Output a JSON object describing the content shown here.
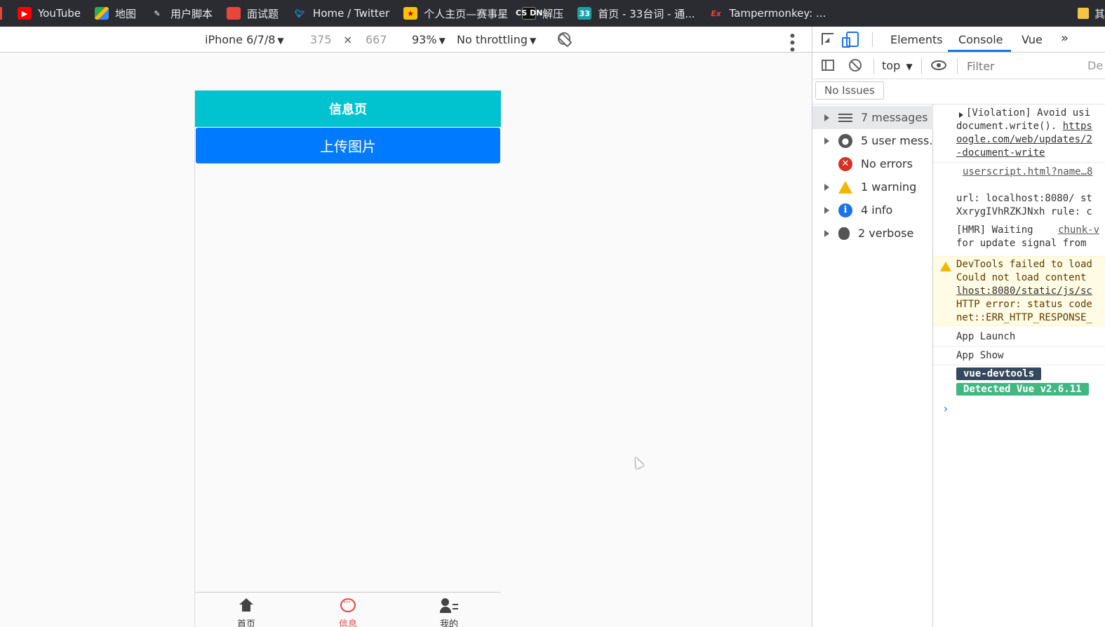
{
  "bookmarks": [
    {
      "label": "YouTube",
      "icon": "youtube-icon"
    },
    {
      "label": "地图",
      "icon": "maps-icon"
    },
    {
      "label": "用户脚本",
      "icon": "userscript-icon"
    },
    {
      "label": "面试题",
      "icon": "interview-icon"
    },
    {
      "label": "Home / Twitter",
      "icon": "twitter-icon"
    },
    {
      "label": "个人主页—赛事星",
      "icon": "star-icon"
    },
    {
      "label": "解压",
      "icon": "csdn-icon"
    },
    {
      "label": "首页 - 33台词 - 通...",
      "icon": "33-icon"
    },
    {
      "label": "Tampermonkey: ...",
      "icon": "ex-icon"
    }
  ],
  "bookmarks_right": {
    "label": "其",
    "icon": "folder-icon"
  },
  "bookmark_icon_texts": {
    "csdn": "CS DN",
    "n33": "33",
    "ex": "Ex"
  },
  "device_toolbar": {
    "device": "iPhone 6/7/8",
    "width": "375",
    "times": "×",
    "height": "667",
    "zoom": "93%",
    "throttle": "No throttling"
  },
  "app": {
    "nav_title": "信息页",
    "upload_button": "上传图片",
    "tabs": [
      {
        "label": "首页",
        "icon": "home-icon"
      },
      {
        "label": "信息",
        "icon": "message-icon"
      },
      {
        "label": "我的",
        "icon": "user-icon"
      }
    ]
  },
  "devtools": {
    "tabs": {
      "elements": "Elements",
      "console": "Console",
      "vue": "Vue",
      "more": "»"
    },
    "context": "top",
    "filter_placeholder": "Filter",
    "default_levels": "De",
    "issues": "No Issues",
    "sidebar": [
      {
        "label": "7 messages",
        "icon": "list-icon",
        "expandable": true
      },
      {
        "label": "5 user mess...",
        "icon": "user-circle-icon",
        "expandable": true
      },
      {
        "label": "No errors",
        "icon": "error-icon",
        "expandable": false
      },
      {
        "label": "1 warning",
        "icon": "warning-icon",
        "expandable": true
      },
      {
        "label": "4 info",
        "icon": "info-icon",
        "expandable": true
      },
      {
        "label": "2 verbose",
        "icon": "bug-icon",
        "expandable": true
      }
    ],
    "log": {
      "violation": [
        "[Violation] Avoid usi",
        "document.write(). ",
        "https",
        "oogle.com/web/updates/2",
        "-document-write"
      ],
      "source_link": "userscript.html?name…8",
      "url_line1": "url: localhost:8080/ st",
      "url_line2": "XxrygIVhRZKJNxh rule: c",
      "hmr_line1": "[HMR] Waiting",
      "hmr_link": "chunk-v",
      "hmr_line2": "for update signal from",
      "warn_lines": [
        "DevTools failed to load",
        "Could not load content",
        "lhost:8080/static/js/sc",
        "HTTP error: status code",
        "net::ERR_HTTP_RESPONSE_"
      ],
      "app_launch": "App Launch",
      "app_show": "App Show",
      "badge1": "vue-devtools",
      "badge2": "Detected Vue v2.6.11",
      "prompt": "›"
    }
  },
  "colors": {
    "nav_bg": "#00c3cf",
    "upload_bg": "#007bff",
    "active_tab": "#e8453c",
    "console_accent": "#1a73e8",
    "badge_dark": "#35495e",
    "badge_green": "#41b883"
  }
}
